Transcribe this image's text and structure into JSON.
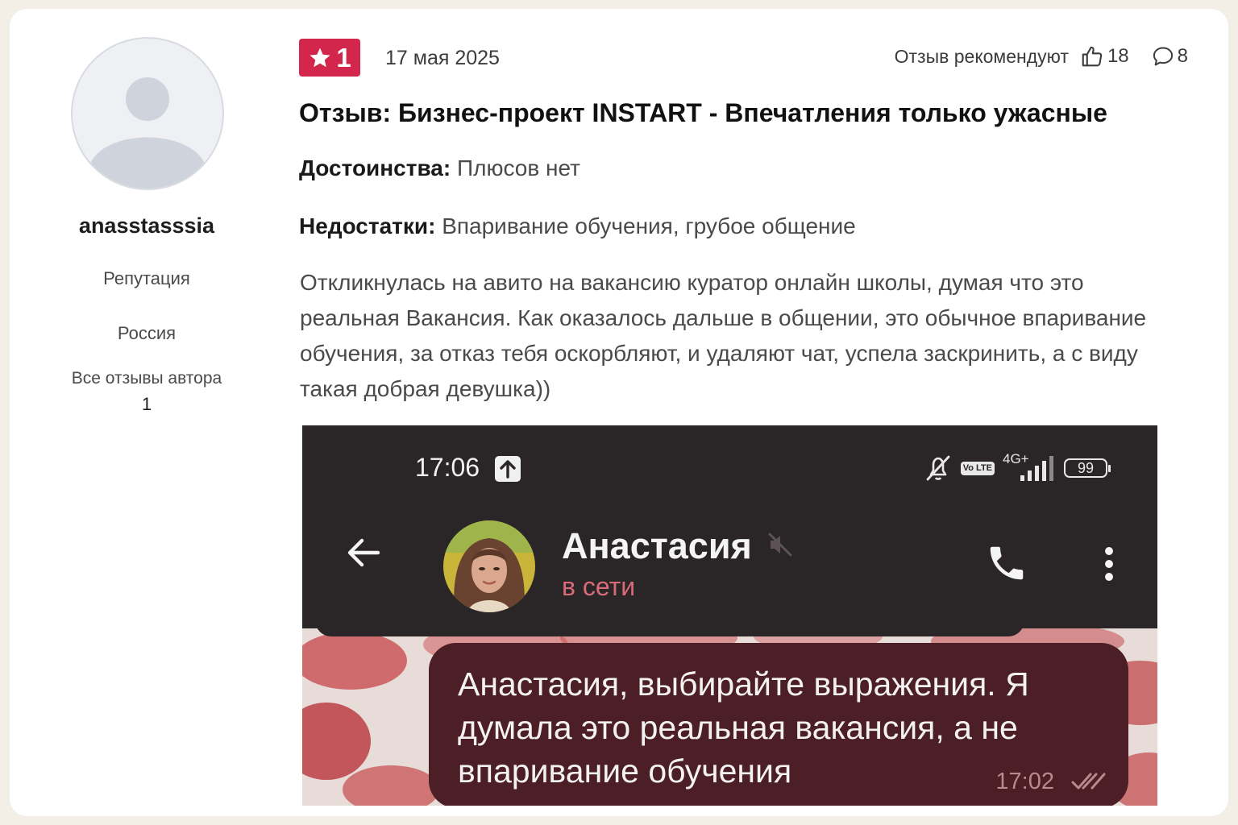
{
  "author": {
    "name": "anasstasssia",
    "reputation_label": "Репутация",
    "country": "Россия",
    "all_reviews_label": "Все отзывы автора",
    "reviews_count": "1"
  },
  "review": {
    "rating": "1",
    "date": "17 мая 2025",
    "recommend_label": "Отзыв рекомендуют",
    "likes": "18",
    "comments": "8",
    "title": "Отзыв: Бизнес-проект INSTART - Впечатления только ужасные",
    "pros_label": "Достоинства:",
    "pros": "Плюсов нет",
    "cons_label": "Недостатки:",
    "cons": "Впаривание обучения, грубое общение",
    "body": "Откликнулась на авито на вакансию куратор онлайн школы, думая что это реальная Вакансия. Как оказалось дальше в общении, это обычное впаривание обучения, за отказ тебя оскорбляют, и удаляют чат, успела заскринить, а с виду такая добрая девушка))"
  },
  "screenshot": {
    "status_time": "17:06",
    "network": "4G+",
    "volte": "Vo LTE",
    "battery": "99",
    "contact_name": "Анастасия",
    "contact_status": "в сети",
    "message_text": "Анастасия, выбирайте выражения. Я думала это реальная вакансия, а не впаривание обучения",
    "message_time": "17:02"
  },
  "colors": {
    "rating_badge": "#d3264c",
    "chat_header": "#2a2628",
    "bubble": "#4c1f27",
    "online_status": "#d96a78"
  }
}
